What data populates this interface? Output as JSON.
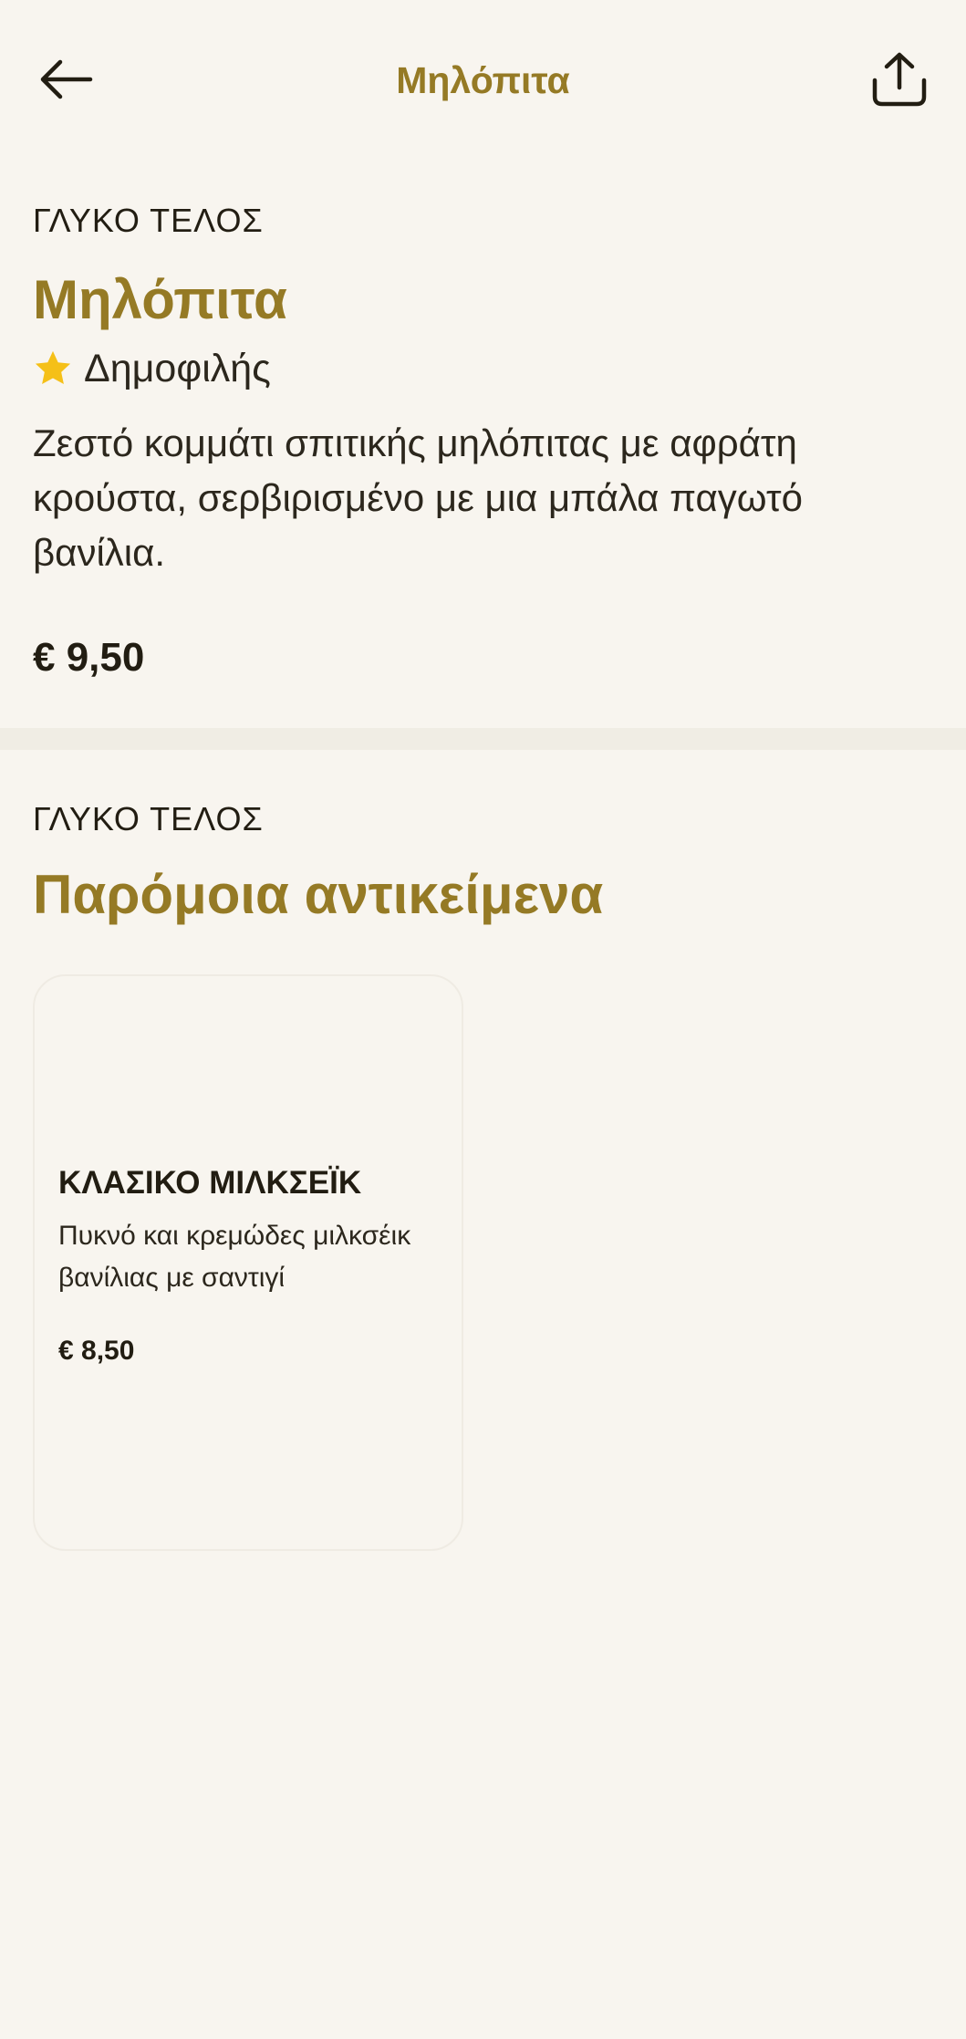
{
  "header": {
    "title": "Μηλόπιτα",
    "back_icon": "arrow-left-icon",
    "share_icon": "share-icon"
  },
  "item": {
    "category": "ΓΛΥΚΟ ΤΕΛΟΣ",
    "name": "Μηλόπιτα",
    "badge": "Δημοφιλής",
    "badge_icon": "star-icon",
    "description": "Ζεστό κομμάτι σπιτικής μηλόπιτας με αφράτη κρούστα, σερβιρισμένο με μια μπάλα παγωτό βανίλια.",
    "price": "€ 9,50"
  },
  "similar": {
    "category": "ΓΛΥΚΟ ΤΕΛΟΣ",
    "heading": "Παρόμοια αντικείμενα",
    "items": [
      {
        "name": "ΚΛΑΣΙΚΟ ΜΙΛΚΣΕΪΚ",
        "description": "Πυκνό και κρεμώδες μιλκσέικ βανίλιας με σαντιγί",
        "price": "€ 8,50"
      }
    ]
  },
  "colors": {
    "background": "#F8F5EF",
    "accent": "#957A25",
    "text": "#221D12",
    "star": "#F5C018",
    "divider": "#F0EDE4"
  }
}
